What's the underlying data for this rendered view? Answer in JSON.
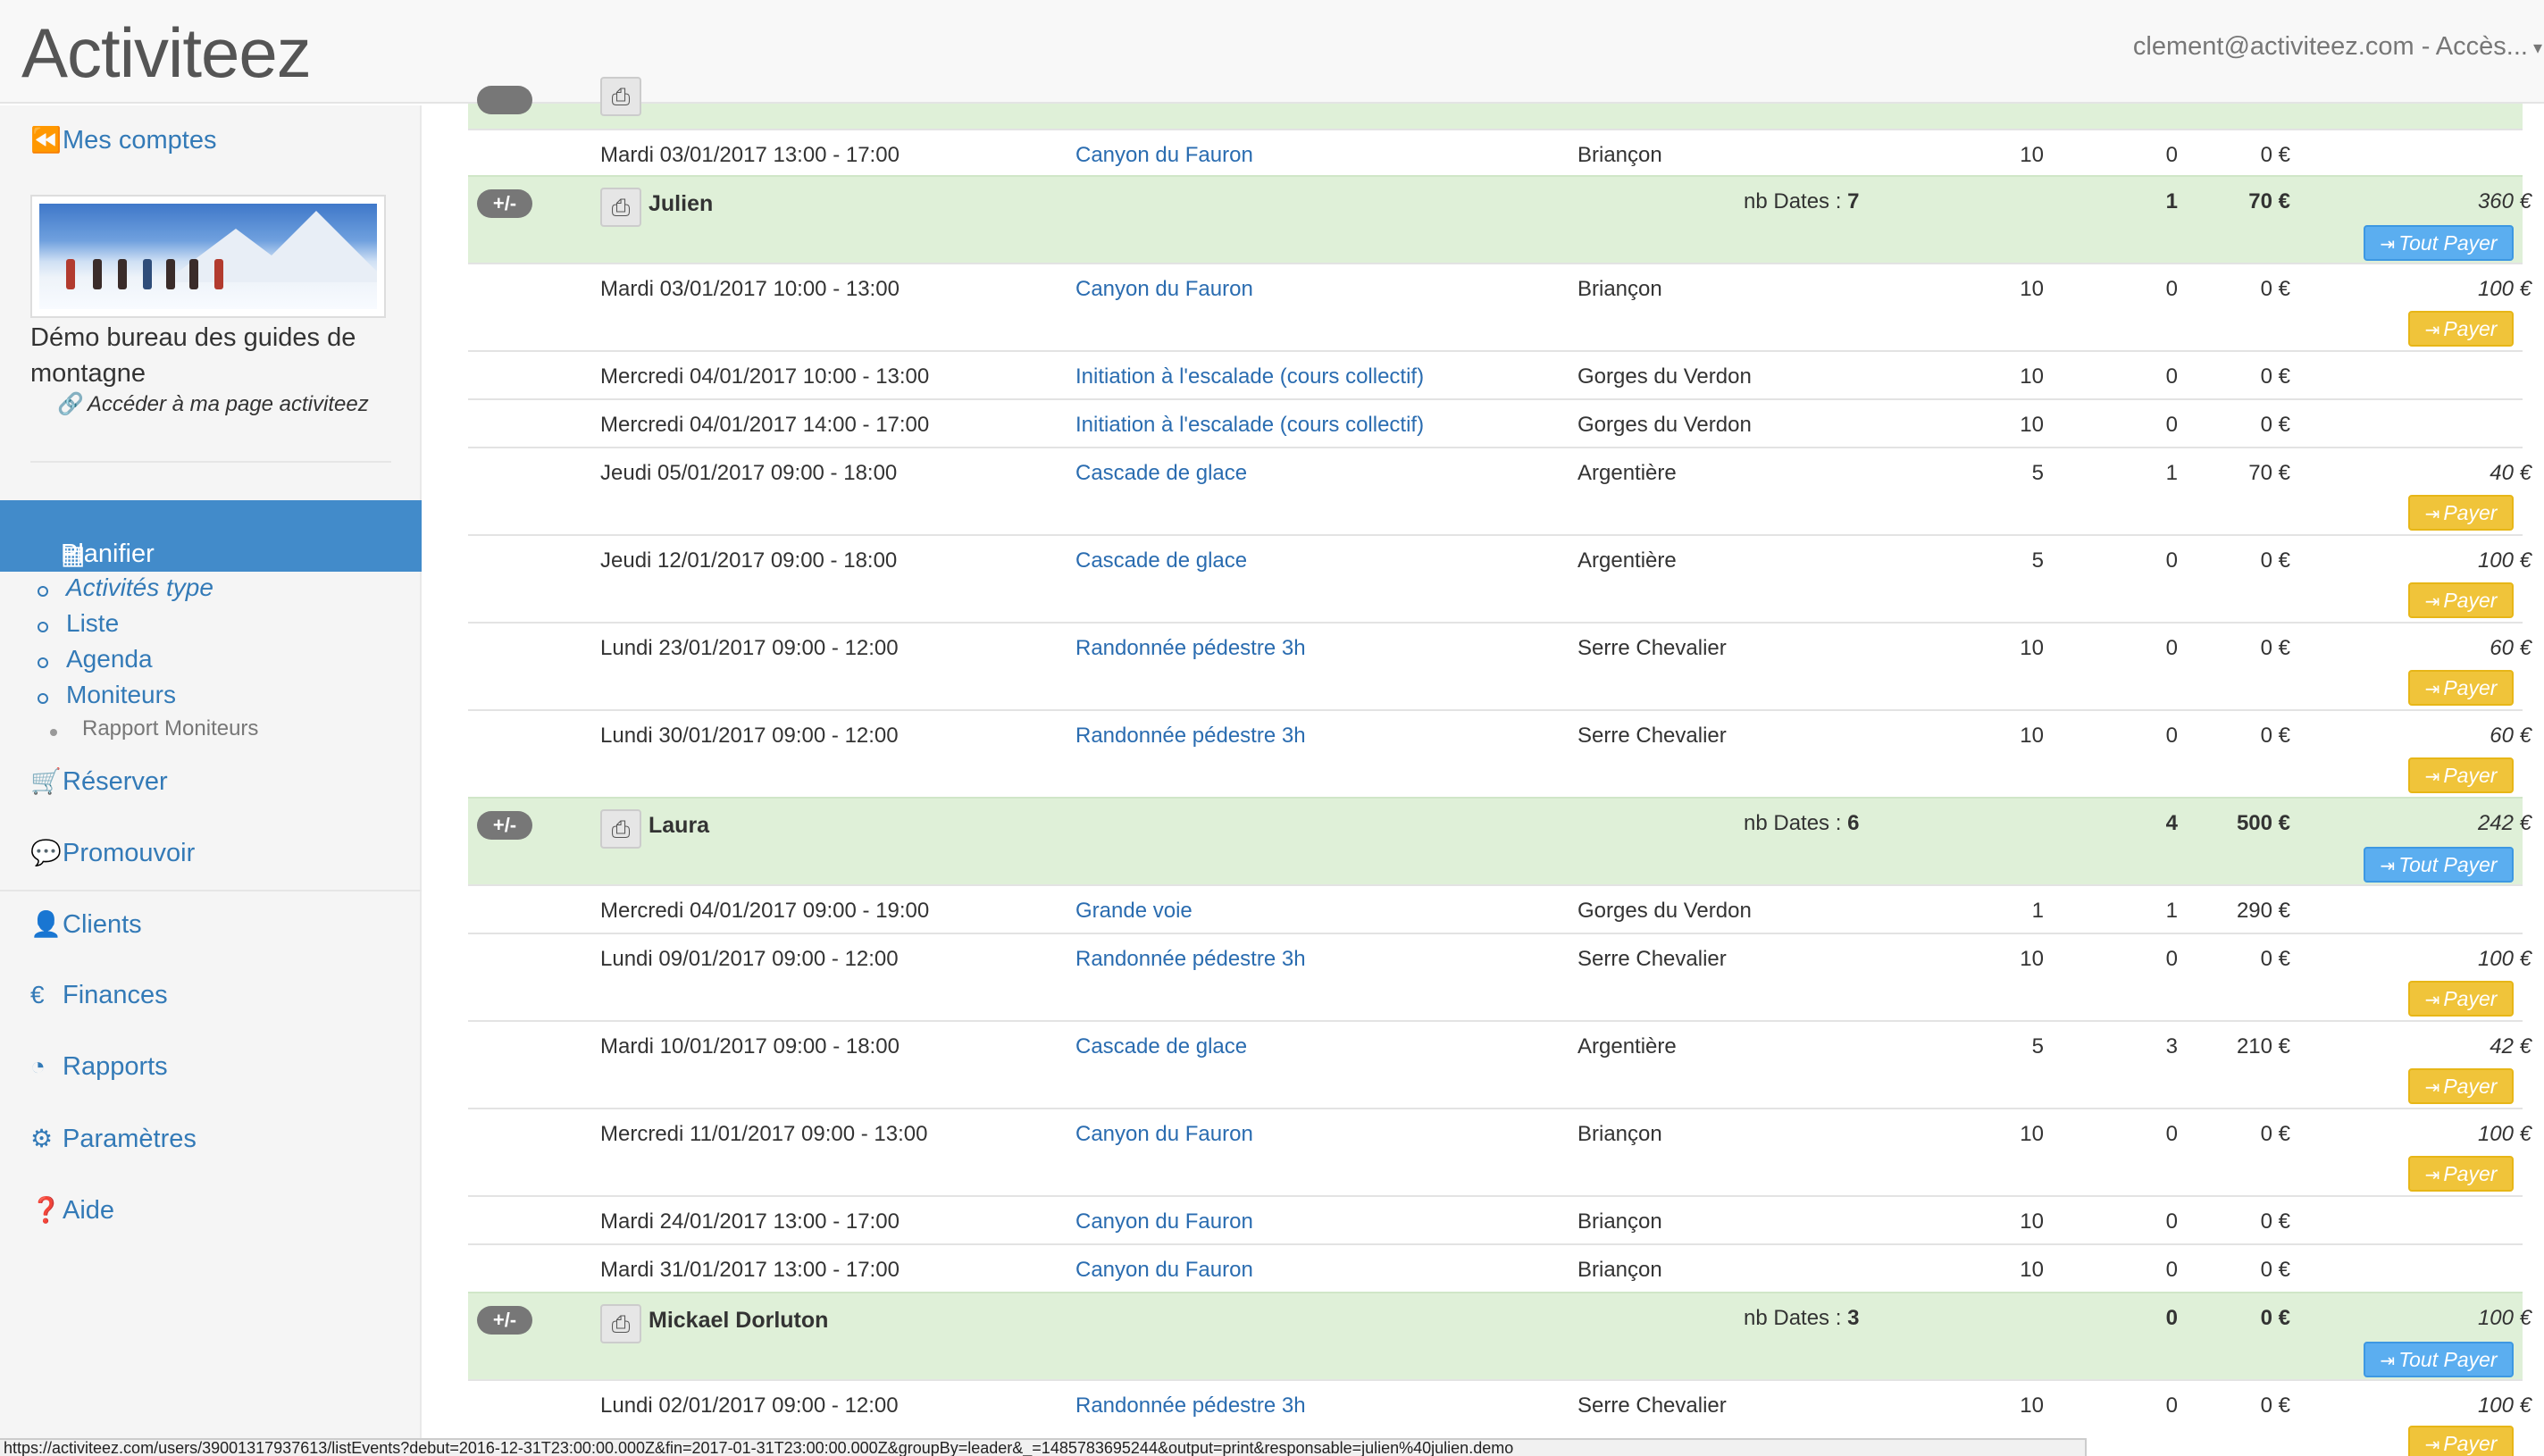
{
  "header": {
    "brand": "Activiteez",
    "user": "clement@activiteez.com - Accès..."
  },
  "sidebar": {
    "my_accounts": "Mes comptes",
    "org_name": "Démo bureau des guides de montagne",
    "page_link": "Accéder à ma page activiteez",
    "active_section": "Planifier",
    "sub_items": [
      "Activités type",
      "Liste",
      "Agenda",
      "Moniteurs"
    ],
    "sub_sub_item": "Rapport Moniteurs",
    "sections": [
      "Réserver",
      "Promouvoir",
      "Clients",
      "Finances",
      "Rapports",
      "Paramètres",
      "Aide"
    ]
  },
  "table": {
    "top_row": {
      "date": "Mardi 03/01/2017 13:00 - 17:00",
      "activity": "Canyon du Fauron",
      "place": "Briançon",
      "n1": "10",
      "n2": "0",
      "amount": "0 €"
    },
    "groups": [
      {
        "name": "Julien",
        "nb_label": "nb Dates : ",
        "nb": "7",
        "participants": "1",
        "total": "70 €",
        "due": "360 €",
        "pay_all": "Tout Payer",
        "rows": [
          {
            "date": "Mardi 03/01/2017 10:00 - 13:00",
            "activity": "Canyon du Fauron",
            "place": "Briançon",
            "n1": "10",
            "n2": "0",
            "amount": "0 €",
            "due": "100 €",
            "pay": "Payer"
          },
          {
            "date": "Mercredi 04/01/2017 10:00 - 13:00",
            "activity": "Initiation à l'escalade (cours collectif)",
            "place": "Gorges du Verdon",
            "n1": "10",
            "n2": "0",
            "amount": "0 €",
            "due": "",
            "pay": ""
          },
          {
            "date": "Mercredi 04/01/2017 14:00 - 17:00",
            "activity": "Initiation à l'escalade (cours collectif)",
            "place": "Gorges du Verdon",
            "n1": "10",
            "n2": "0",
            "amount": "0 €",
            "due": "",
            "pay": ""
          },
          {
            "date": "Jeudi 05/01/2017 09:00 - 18:00",
            "activity": "Cascade de glace",
            "place": "Argentière",
            "n1": "5",
            "n2": "1",
            "amount": "70 €",
            "due": "40 €",
            "pay": "Payer"
          },
          {
            "date": "Jeudi 12/01/2017 09:00 - 18:00",
            "activity": "Cascade de glace",
            "place": "Argentière",
            "n1": "5",
            "n2": "0",
            "amount": "0 €",
            "due": "100 €",
            "pay": "Payer"
          },
          {
            "date": "Lundi 23/01/2017 09:00 - 12:00",
            "activity": "Randonnée pédestre 3h",
            "place": "Serre Chevalier",
            "n1": "10",
            "n2": "0",
            "amount": "0 €",
            "due": "60 €",
            "pay": "Payer"
          },
          {
            "date": "Lundi 30/01/2017 09:00 - 12:00",
            "activity": "Randonnée pédestre 3h",
            "place": "Serre Chevalier",
            "n1": "10",
            "n2": "0",
            "amount": "0 €",
            "due": "60 €",
            "pay": "Payer"
          }
        ]
      },
      {
        "name": "Laura",
        "nb_label": "nb Dates : ",
        "nb": "6",
        "participants": "4",
        "total": "500 €",
        "due": "242 €",
        "pay_all": "Tout Payer",
        "rows": [
          {
            "date": "Mercredi 04/01/2017 09:00 - 19:00",
            "activity": "Grande voie",
            "place": "Gorges du Verdon",
            "n1": "1",
            "n2": "1",
            "amount": "290 €",
            "due": "",
            "pay": ""
          },
          {
            "date": "Lundi 09/01/2017 09:00 - 12:00",
            "activity": "Randonnée pédestre 3h",
            "place": "Serre Chevalier",
            "n1": "10",
            "n2": "0",
            "amount": "0 €",
            "due": "100 €",
            "pay": "Payer"
          },
          {
            "date": "Mardi 10/01/2017 09:00 - 18:00",
            "activity": "Cascade de glace",
            "place": "Argentière",
            "n1": "5",
            "n2": "3",
            "amount": "210 €",
            "due": "42 €",
            "pay": "Payer"
          },
          {
            "date": "Mercredi 11/01/2017 09:00 - 13:00",
            "activity": "Canyon du Fauron",
            "place": "Briançon",
            "n1": "10",
            "n2": "0",
            "amount": "0 €",
            "due": "100 €",
            "pay": "Payer"
          },
          {
            "date": "Mardi 24/01/2017 13:00 - 17:00",
            "activity": "Canyon du Fauron",
            "place": "Briançon",
            "n1": "10",
            "n2": "0",
            "amount": "0 €",
            "due": "",
            "pay": ""
          },
          {
            "date": "Mardi 31/01/2017 13:00 - 17:00",
            "activity": "Canyon du Fauron",
            "place": "Briançon",
            "n1": "10",
            "n2": "0",
            "amount": "0 €",
            "due": "",
            "pay": ""
          }
        ]
      },
      {
        "name": "Mickael Dorluton",
        "nb_label": "nb Dates : ",
        "nb": "3",
        "participants": "0",
        "total": "0 €",
        "due": "100 €",
        "pay_all": "Tout Payer",
        "rows": [
          {
            "date": "Lundi 02/01/2017 09:00 - 12:00",
            "activity": "Randonnée pédestre 3h",
            "place": "Serre Chevalier",
            "n1": "10",
            "n2": "0",
            "amount": "0 €",
            "due": "100 €",
            "pay": "Payer"
          }
        ]
      }
    ],
    "toggle_label": "+/-"
  },
  "status_url": "https://activiteez.com/users/39001317937613/listEvents?debut=2016-12-31T23:00:00.000Z&fin=2017-01-31T23:00:00.000Z&groupBy=leader&_=1485783695244&output=print&responsable=julien%40julien.demo"
}
